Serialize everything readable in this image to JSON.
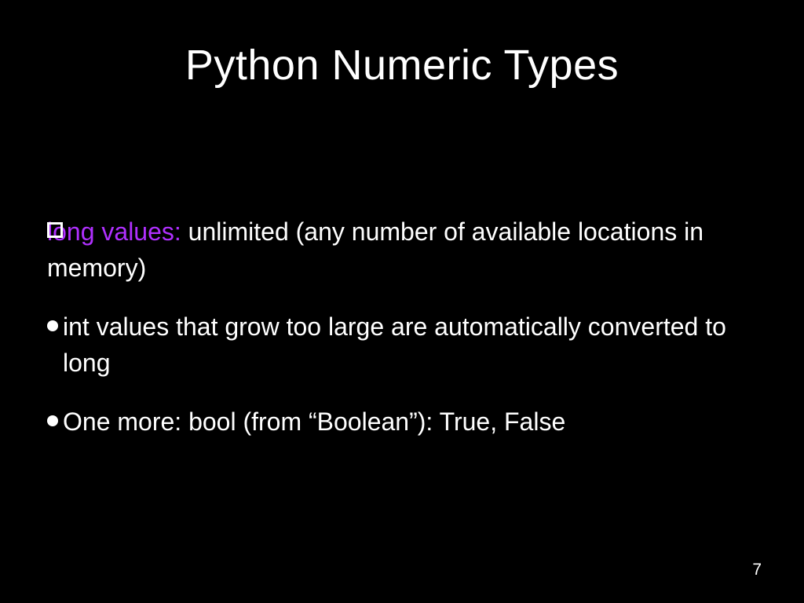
{
  "slide": {
    "title": "Python Numeric Types",
    "bullets": [
      {
        "highlight": "long values:",
        "rest": " unlimited (any number of available locations in memory)"
      },
      {
        "text": "int values that grow too large are automatically converted to long"
      },
      {
        "text": "One more: bool (from “Boolean”): True, False"
      }
    ],
    "page_number": "7"
  }
}
